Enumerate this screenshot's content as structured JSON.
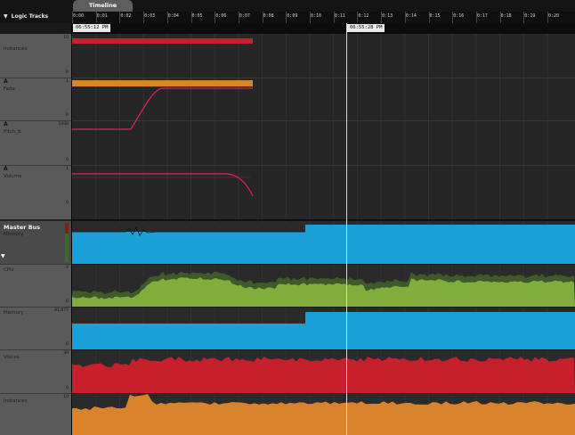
{
  "app": {
    "logic_tracks_label": "Logic Tracks",
    "timeline_tab": "Timeline"
  },
  "ruler": {
    "ticks": [
      "0:00",
      "0:01",
      "0:02",
      "0:03",
      "0:04",
      "0:05",
      "0:06",
      "0:07",
      "0:08",
      "0:09",
      "0:10",
      "0:11",
      "0:12",
      "0:13",
      "0:14",
      "0:15",
      "0:16",
      "0:17",
      "0:18",
      "0:19",
      "0:20"
    ]
  },
  "markers": {
    "start": "06:55:12 PM",
    "playhead": "06:55:28 PM"
  },
  "tracks": {
    "instances": {
      "label": "Instances",
      "max": "10",
      "min": "0"
    },
    "fade": {
      "letter": "A",
      "label": "Fade",
      "max": "1",
      "min": "0"
    },
    "pitch": {
      "letter": "A",
      "label": "Pitch_b",
      "max": "1000",
      "min": "0"
    },
    "volume": {
      "letter": "A",
      "label": "Volume",
      "max": "1",
      "min": "0"
    },
    "master": {
      "title": "Master Bus",
      "sub": "Memory"
    },
    "cpu": {
      "label": "CPU",
      "max": "2",
      "min": "0"
    },
    "memory": {
      "label": "Memory",
      "max": "81,677",
      "min": "0"
    },
    "voices": {
      "label": "Voices",
      "max": "30",
      "min": "0"
    },
    "instances2": {
      "label": "Instances",
      "max": "10",
      "min": "0"
    }
  },
  "colors": {
    "red": "#c5202b",
    "orange": "#d9832a",
    "pink": "#e0245a",
    "blue": "#1aa0d6",
    "green": "#7fae3c",
    "dark_green": "#3f5a28"
  }
}
